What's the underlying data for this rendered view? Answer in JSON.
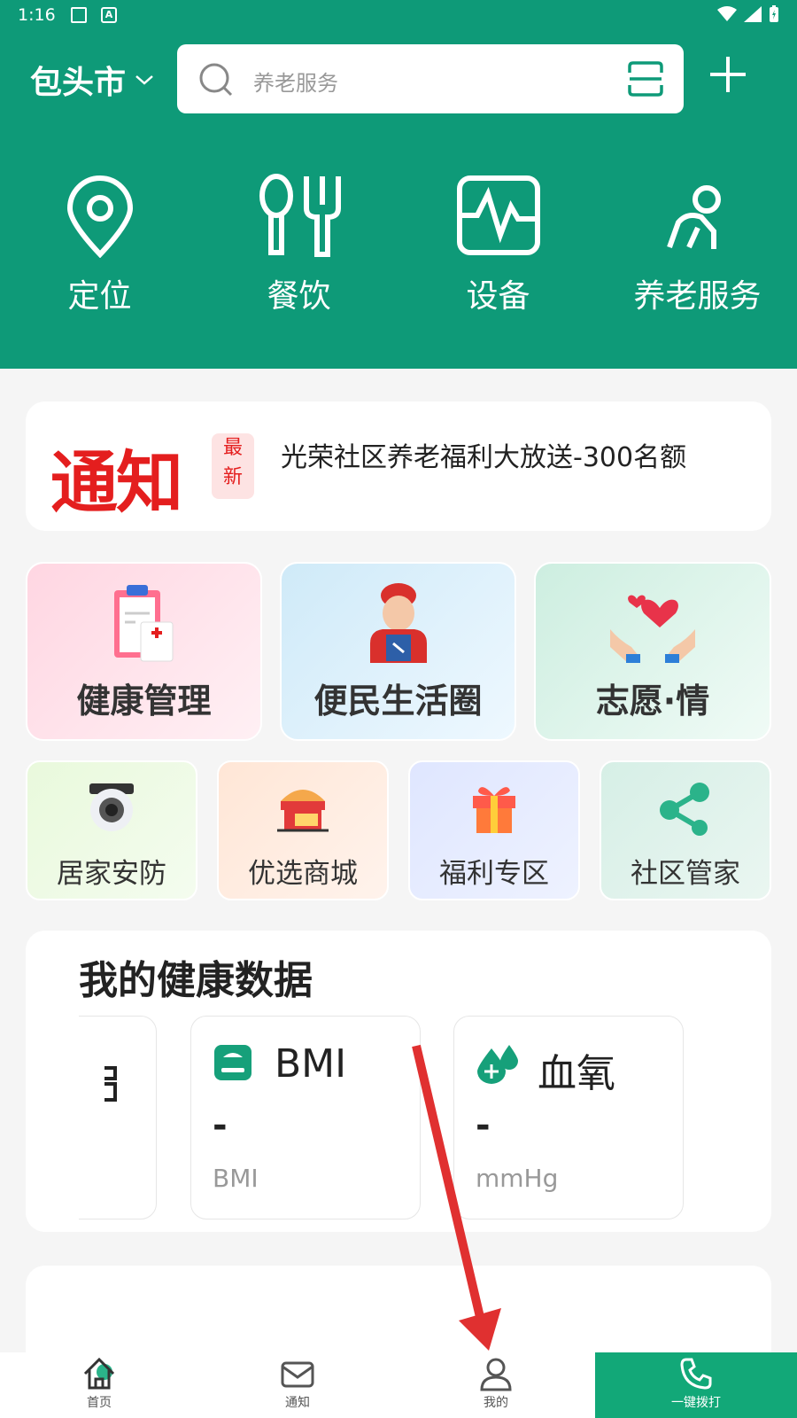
{
  "status_bar": {
    "time": "1:16",
    "a_label": "A"
  },
  "header": {
    "city": "包头市",
    "search_placeholder": "养老服务",
    "quick_items": [
      {
        "label": "定位",
        "icon": "location-pin-icon"
      },
      {
        "label": "餐饮",
        "icon": "spoon-fork-icon"
      },
      {
        "label": "设备",
        "icon": "heartbeat-monitor-icon"
      },
      {
        "label": "养老服务",
        "icon": "elder-person-icon"
      }
    ]
  },
  "notice": {
    "title": "通知",
    "badge_line1": "最",
    "badge_line2": "新",
    "text": "光荣社区养老福利大放送-300名额"
  },
  "tiles_large": [
    {
      "label": "健康管理",
      "icon": "clipboard-medical-icon"
    },
    {
      "label": "便民生活圈",
      "icon": "worker-icon"
    },
    {
      "label": "志愿·情",
      "icon": "hands-hearts-icon"
    }
  ],
  "tiles_small": [
    {
      "label": "居家安防",
      "icon": "camera-icon"
    },
    {
      "label": "优选商城",
      "icon": "store-icon"
    },
    {
      "label": "福利专区",
      "icon": "gift-icon"
    },
    {
      "label": "社区管家",
      "icon": "share-icon"
    }
  ],
  "health": {
    "title": "我的健康数据",
    "cards": [
      {
        "name": "BMI",
        "value": "-",
        "unit": "BMI",
        "icon": "scale-icon"
      },
      {
        "name": "血氧",
        "value": "-",
        "unit": "mmHg",
        "icon": "blood-drops-icon"
      }
    ]
  },
  "nav": [
    {
      "label": "首页",
      "icon": "home-icon"
    },
    {
      "label": "通知",
      "icon": "mail-icon"
    },
    {
      "label": "我的",
      "icon": "user-icon"
    },
    {
      "label": "一键拨打",
      "icon": "phone-icon"
    }
  ],
  "colors": {
    "brand": "#0e9a78",
    "accent_red": "#e41e1e",
    "call_button": "#12a878"
  }
}
